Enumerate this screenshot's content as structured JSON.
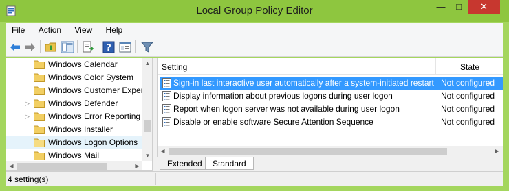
{
  "window": {
    "title": "Local Group Policy Editor",
    "minimize_glyph": "—",
    "maximize_glyph": "□",
    "close_glyph": "✕",
    "accent_color": "#8ec63f"
  },
  "menu": {
    "items": [
      "File",
      "Action",
      "View",
      "Help"
    ]
  },
  "toolbar": {
    "icons": [
      "back-arrow-icon",
      "forward-arrow-icon",
      "up-folder-icon",
      "show-hide-tree-icon",
      "export-list-icon",
      "help-icon",
      "properties-icon",
      "filter-icon"
    ]
  },
  "tree": {
    "items": [
      {
        "label": "Windows Calendar",
        "expandable": false
      },
      {
        "label": "Windows Color System",
        "expandable": false
      },
      {
        "label": "Windows Customer Exper",
        "expandable": false
      },
      {
        "label": "Windows Defender",
        "expandable": true
      },
      {
        "label": "Windows Error Reporting",
        "expandable": true
      },
      {
        "label": "Windows Installer",
        "expandable": false
      },
      {
        "label": "Windows Logon Options",
        "expandable": false,
        "selected": true
      },
      {
        "label": "Windows Mail",
        "expandable": false
      }
    ]
  },
  "list": {
    "columns": {
      "setting": "Setting",
      "state": "State"
    },
    "rows": [
      {
        "setting": "Sign-in last interactive user automatically after a system-initiated restart",
        "state": "Not configured",
        "selected": true
      },
      {
        "setting": "Display information about previous logons during user logon",
        "state": "Not configured"
      },
      {
        "setting": "Report when logon server was not available during user logon",
        "state": "Not configured"
      },
      {
        "setting": "Disable or enable software Secure Attention Sequence",
        "state": "Not configured"
      }
    ]
  },
  "tabs": {
    "extended": "Extended",
    "standard": "Standard",
    "active": "Standard"
  },
  "status": {
    "text": "4 setting(s)"
  }
}
